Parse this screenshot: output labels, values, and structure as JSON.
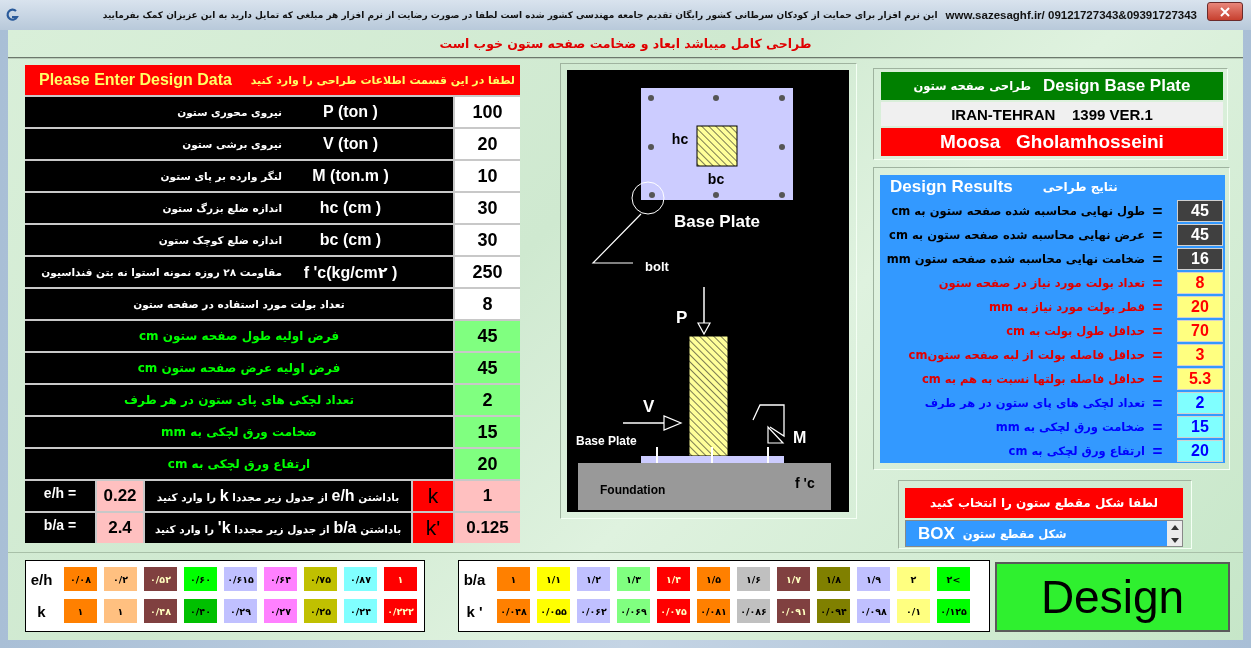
{
  "window": {
    "title_message": "این نرم افزار برای حمایت از کودکان سرطانی کشور رایگان تقدیم جامعه مهندسی کشور شده است لطفا در صورت رضایت از نرم افزار  هر مبلغی که تمایل دارید به این عزیزان کمک بفرمایید",
    "title_url": "www.sazesaghf.ir/ 09121727343&09391727343"
  },
  "status_message": "طراحی کامل میباشد ابعاد و ضخامت صفحه ستون خوب است",
  "input_panel": {
    "title": "Please Enter Design Data",
    "instruction": "لطفا در این قسمت اطلاعات طراحی را وارد کنید",
    "rows": [
      {
        "kind": "input",
        "symbol": "P (ton )",
        "label": "نیروی محوری ستون",
        "value": "100"
      },
      {
        "kind": "input",
        "symbol": "V (ton )",
        "label": "نیروی برشی ستون",
        "value": "20"
      },
      {
        "kind": "input",
        "symbol": "M (ton.m )",
        "label": "لنگر وارده بر پای ستون",
        "value": "10"
      },
      {
        "kind": "input",
        "symbol": "hc (cm )",
        "label": "اندازه ضلع بزرگ ستون",
        "value": "30"
      },
      {
        "kind": "input",
        "symbol": "bc (cm )",
        "label": "اندازه ضلع کوچک ستون",
        "value": "30"
      },
      {
        "kind": "input",
        "symbol": "f 'c(kg/cm۲ )",
        "label": "مقاومت ۲۸ روزه نمونه استوا نه بتن فنداسیون",
        "value": "250"
      },
      {
        "kind": "input",
        "label": "تعداد بولت مورد استفاده  در صفحه  ستون",
        "value": "8"
      },
      {
        "kind": "assumed",
        "label": "فرض  اولیه طول صفحه ستون cm",
        "value": "45"
      },
      {
        "kind": "assumed",
        "label": "فرض اولیه عرض صفحه ستون cm",
        "value": "45"
      },
      {
        "kind": "assumed",
        "label": "تعداد لچکی های پای ستون در هر طرف",
        "value": "2"
      },
      {
        "kind": "assumed",
        "label": "ضخامت ورق لچکی به mm",
        "value": "15"
      },
      {
        "kind": "assumed",
        "label": "ارتفاع ورق لچکی به cm",
        "value": "20"
      }
    ],
    "coefficients": [
      {
        "ratio_label": "e/h =",
        "ratio": "0.22",
        "instruction": "باداشتن **e/h** از جدول زیر مجددا **k** را وارد کنید",
        "coefficient": "k",
        "value": "1"
      },
      {
        "ratio_label": "b/a =",
        "ratio": "2.4",
        "instruction": "باداشتن **b/a** از جدول زیر مجددا  **k'** را وارد کنید",
        "coefficient": "k'",
        "value": "0.125"
      }
    ]
  },
  "diagram": {
    "labels": {
      "plan_height": "hc",
      "plan_width": "bc",
      "plan_title": "Base Plate",
      "bolt": "bolt",
      "axial_load": "P",
      "shear_load": "V",
      "moment": "M",
      "elevation_plate": "Base Plate",
      "foundation": "Foundation",
      "concrete_strength": "f 'c"
    }
  },
  "title_panel": {
    "persian": "طراحی صفحه ستون",
    "english": "Design Base Plate",
    "location_version": "IRAN-TEHRAN    1399 VER.1",
    "author": "Moosa   Gholamhosseini"
  },
  "results": {
    "title": "Design Results",
    "subtitle": "نتایج طراحی",
    "rows": [
      {
        "kind": "plate",
        "label": "طول نهایی محاسبه شده صفحه ستون به cm",
        "sign": "=",
        "value": "45"
      },
      {
        "kind": "plate",
        "label": "عرض نهایی محاسبه شده صفحه ستون به cm",
        "sign": "=",
        "value": "45"
      },
      {
        "kind": "plate",
        "label": "ضخامت نهایی محاسبه شده صفحه ستون mm",
        "sign": "=",
        "value": "16"
      },
      {
        "kind": "bolt",
        "label": "تعداد بولت مورد نیاز در صفحه ستون",
        "sign": "=",
        "value": "8"
      },
      {
        "kind": "bolt",
        "label": "قطر بولت مورد نیاز به mm",
        "sign": "=",
        "value": "20"
      },
      {
        "kind": "bolt",
        "label": "حداقل طول بولت به cm",
        "sign": "=",
        "value": "70"
      },
      {
        "kind": "bolt",
        "label": "حداقل فاصله بولت از لبه صفحه ستونcm",
        "sign": "=",
        "value": "3"
      },
      {
        "kind": "bolt",
        "label": "حداقل فاصله بولتها نسبت به هم به cm",
        "sign": "=",
        "value": "5.3"
      },
      {
        "kind": "stiffener",
        "label": "تعداد لچکی های پای ستون در هر طرف",
        "sign": "=",
        "value": "2"
      },
      {
        "kind": "stiffener",
        "label": "ضخامت ورق لچکی به mm",
        "sign": "=",
        "value": "15"
      },
      {
        "kind": "stiffener",
        "label": "ارتفاع ورق لچکی به cm",
        "sign": "=",
        "value": "20"
      }
    ]
  },
  "section_select": {
    "prompt": "لطفا شکل مقطع ستون را انتخاب کنید",
    "caption": "شکل مقطع ستون",
    "options": [
      {
        "label": "BOX",
        "selected": true
      }
    ]
  },
  "eh_table": {
    "rows": [
      {
        "label": "e/h",
        "cells": [
          {
            "text": "۱",
            "color": "#ff0000"
          },
          {
            "text": "۰/۸۷",
            "color": "#80ffff"
          },
          {
            "text": "۰/۷۵",
            "color": "#c0c000"
          },
          {
            "text": "۰/۶۴",
            "color": "#ff80ff"
          },
          {
            "text": "۰/۶۱۵",
            "color": "#c0c0ff"
          },
          {
            "text": "۰/۶۰",
            "color": "#00ff00"
          },
          {
            "text": "۰/۵۲",
            "color": "#804040"
          },
          {
            "text": "۰/۲",
            "color": "#ffc080"
          },
          {
            "text": "۰/۰۸",
            "color": "#ff8000"
          }
        ]
      },
      {
        "label": "k",
        "cells": [
          {
            "text": "۰/۲۲۲",
            "color": "#ff0000"
          },
          {
            "text": "۰/۲۴",
            "color": "#80ffff"
          },
          {
            "text": "۰/۲۵",
            "color": "#c0c000"
          },
          {
            "text": "۰/۲۷",
            "color": "#ff80ff"
          },
          {
            "text": "۰/۲۹",
            "color": "#c0c0ff"
          },
          {
            "text": "۰/۴۰",
            "color": "#00c000"
          },
          {
            "text": "۰/۴۸",
            "color": "#804040"
          },
          {
            "text": "۱",
            "color": "#ffc080"
          },
          {
            "text": "۱",
            "color": "#ff8000"
          }
        ]
      }
    ]
  },
  "ba_table": {
    "rows": [
      {
        "label": "b/a",
        "cells": [
          {
            "text": "۲<",
            "color": "#00ff00"
          },
          {
            "text": "۲",
            "color": "#ffff80"
          },
          {
            "text": "۱/۹",
            "color": "#c0c0ff"
          },
          {
            "text": "۱/۸",
            "color": "#808000"
          },
          {
            "text": "۱/۷",
            "color": "#804040"
          },
          {
            "text": "۱/۶",
            "color": "#c0c0c0"
          },
          {
            "text": "۱/۵",
            "color": "#ff8000"
          },
          {
            "text": "۱/۴",
            "color": "#ff0000"
          },
          {
            "text": "۱/۳",
            "color": "#80ff80"
          },
          {
            "text": "۱/۲",
            "color": "#c0c0ff"
          },
          {
            "text": "۱/۱",
            "color": "#ffff00"
          },
          {
            "text": "۱",
            "color": "#ff8000"
          }
        ]
      },
      {
        "label": "k '",
        "cells": [
          {
            "text": "۰/۱۲۵",
            "color": "#00ff00"
          },
          {
            "text": "۰/۱",
            "color": "#ffff80"
          },
          {
            "text": "۰/۰۹۸",
            "color": "#c0c0ff"
          },
          {
            "text": "۰/۰۹۴",
            "color": "#808000"
          },
          {
            "text": "۰/۰۹۱",
            "color": "#804040"
          },
          {
            "text": "۰/۰۸۶",
            "color": "#c0c0c0"
          },
          {
            "text": "۰/۰۸۱",
            "color": "#ff8000"
          },
          {
            "text": "۰/۰۷۵",
            "color": "#ff0000"
          },
          {
            "text": "۰/۰۶۹",
            "color": "#80ff80"
          },
          {
            "text": "۰/۰۶۲",
            "color": "#c0c0ff"
          },
          {
            "text": "۰/۰۵۵",
            "color": "#ffff00"
          },
          {
            "text": "۰/۰۴۸",
            "color": "#ff8000"
          }
        ]
      }
    ]
  },
  "design_button": "Design"
}
